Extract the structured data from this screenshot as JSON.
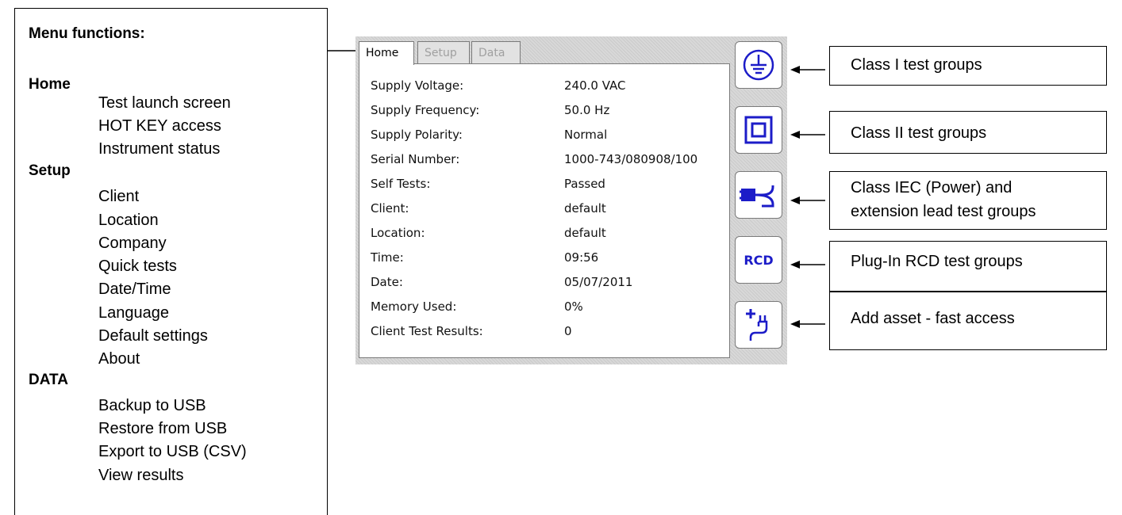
{
  "menu": {
    "title": "Menu functions:",
    "sections": [
      {
        "title": "Home",
        "items": [
          "Test launch screen",
          "HOT KEY access",
          "Instrument status"
        ]
      },
      {
        "title": "Setup",
        "items": [
          "Client",
          "Location",
          "Company",
          "Quick tests",
          "Date/Time",
          "Language",
          "Default settings",
          "About"
        ]
      },
      {
        "title": "DATA",
        "items": [
          "Backup to USB",
          "Restore from USB",
          "Export to USB (CSV)",
          "View results"
        ]
      }
    ]
  },
  "screen": {
    "tabs": [
      {
        "label": "Home",
        "active": true
      },
      {
        "label": "Setup",
        "active": false
      },
      {
        "label": "Data",
        "active": false
      }
    ],
    "status": [
      {
        "label": "Supply Voltage:",
        "value": "240.0 VAC"
      },
      {
        "label": "Supply Frequency:",
        "value": "50.0 Hz"
      },
      {
        "label": "Supply Polarity:",
        "value": "Normal"
      },
      {
        "label": "Serial Number:",
        "value": "1000-743/080908/100"
      },
      {
        "label": "Self Tests:",
        "value": "Passed"
      },
      {
        "label": "Client:",
        "value": "default"
      },
      {
        "label": "Location:",
        "value": "default"
      },
      {
        "label": "Time:",
        "value": "09:56"
      },
      {
        "label": "Date:",
        "value": "05/07/2011"
      },
      {
        "label": "Memory Used:",
        "value": "0%"
      },
      {
        "label": "Client Test Results:",
        "value": "0"
      }
    ],
    "side_buttons": [
      {
        "icon": "protective-earth-icon"
      },
      {
        "icon": "double-insulation-icon"
      },
      {
        "icon": "iec-plug-lead-icon"
      },
      {
        "icon": "rcd-icon",
        "text": "RCD"
      },
      {
        "icon": "add-asset-icon"
      }
    ],
    "accent_color": "#1c1cc8"
  },
  "callouts": [
    {
      "lines": [
        "Class I test groups"
      ]
    },
    {
      "lines": [
        "Class II test groups"
      ]
    },
    {
      "lines": [
        "Class IEC (Power) and",
        "extension lead test groups"
      ]
    },
    {
      "lines": [
        "Plug-In RCD test groups"
      ]
    },
    {
      "lines": [
        "Add asset - fast access"
      ]
    }
  ]
}
